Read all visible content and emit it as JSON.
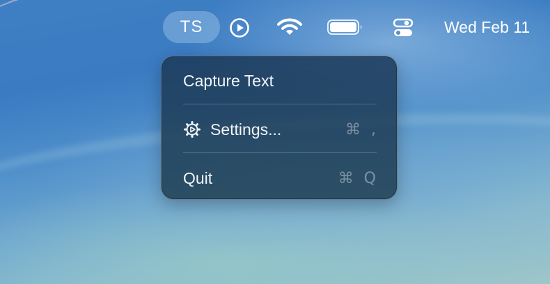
{
  "menubar": {
    "app_badge": "TS",
    "clock": "Wed Feb 11",
    "icons": [
      "play-icon",
      "wifi-icon",
      "battery-icon",
      "control-center-icon"
    ]
  },
  "menu": {
    "items": [
      {
        "label": "Capture Text",
        "shortcut": ""
      },
      {
        "label": "Settings...",
        "shortcut": "⌘ ,",
        "icon": "gear-icon"
      },
      {
        "label": "Quit",
        "shortcut": "⌘ Q"
      }
    ]
  },
  "colors": {
    "menu_bg": "#1f3f5c",
    "menu_text": "#f2f5f8",
    "shortcut_text": "#8ea3b5",
    "badge_bg": "#8fb6d9"
  }
}
